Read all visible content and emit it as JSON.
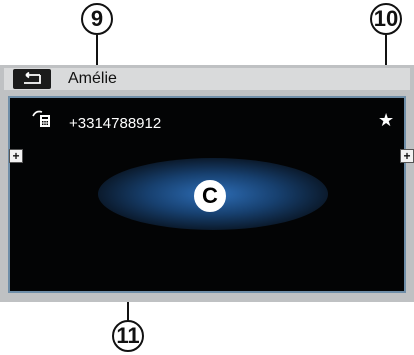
{
  "header": {
    "title": "Amélie",
    "back_icon": "back-arrow-icon"
  },
  "contact": {
    "phone_number": "+3314788912",
    "phone_icon": "mobile-phone-icon",
    "favorite_icon": "star-icon",
    "favorite_symbol": "★"
  },
  "marker": {
    "label": "C"
  },
  "side_controls": {
    "left_label": "+",
    "right_label": "+"
  },
  "callouts": {
    "title_number": "9",
    "favorite_number": "10",
    "phone_number": "11"
  },
  "colors": {
    "screen_bg": "#030405",
    "frame": "#bfc1c3",
    "glow": "#2d6db6",
    "screen_border": "#6f8ea8"
  }
}
